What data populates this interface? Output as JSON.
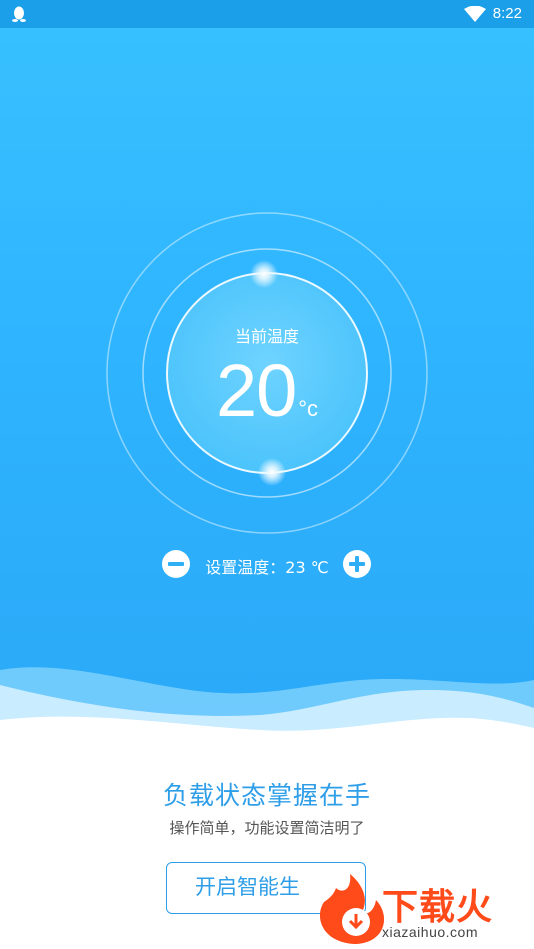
{
  "status_bar": {
    "app_icon": "qq-penguin-icon",
    "wifi_icon": "wifi-icon",
    "time": "8:22"
  },
  "thermostat": {
    "current_label": "当前温度",
    "current_value": "20",
    "current_unit": "°c",
    "setpoint_text": "设置温度：23 ℃",
    "minus_icon": "minus-circle-icon",
    "plus_icon": "plus-circle-icon"
  },
  "promo": {
    "headline": "负载状态掌握在手",
    "subline": "操作简单，功能设置简洁明了",
    "button_label": "开启智能生"
  },
  "watermark": {
    "brand": "下载火",
    "url": "xiazaihuo.com"
  },
  "colors": {
    "status_bar": "#1a9fe8",
    "hero_top": "#37c0ff",
    "hero_bottom": "#2aa9f7",
    "accent": "#2e9ee8",
    "watermark": "#ff4a1a"
  }
}
